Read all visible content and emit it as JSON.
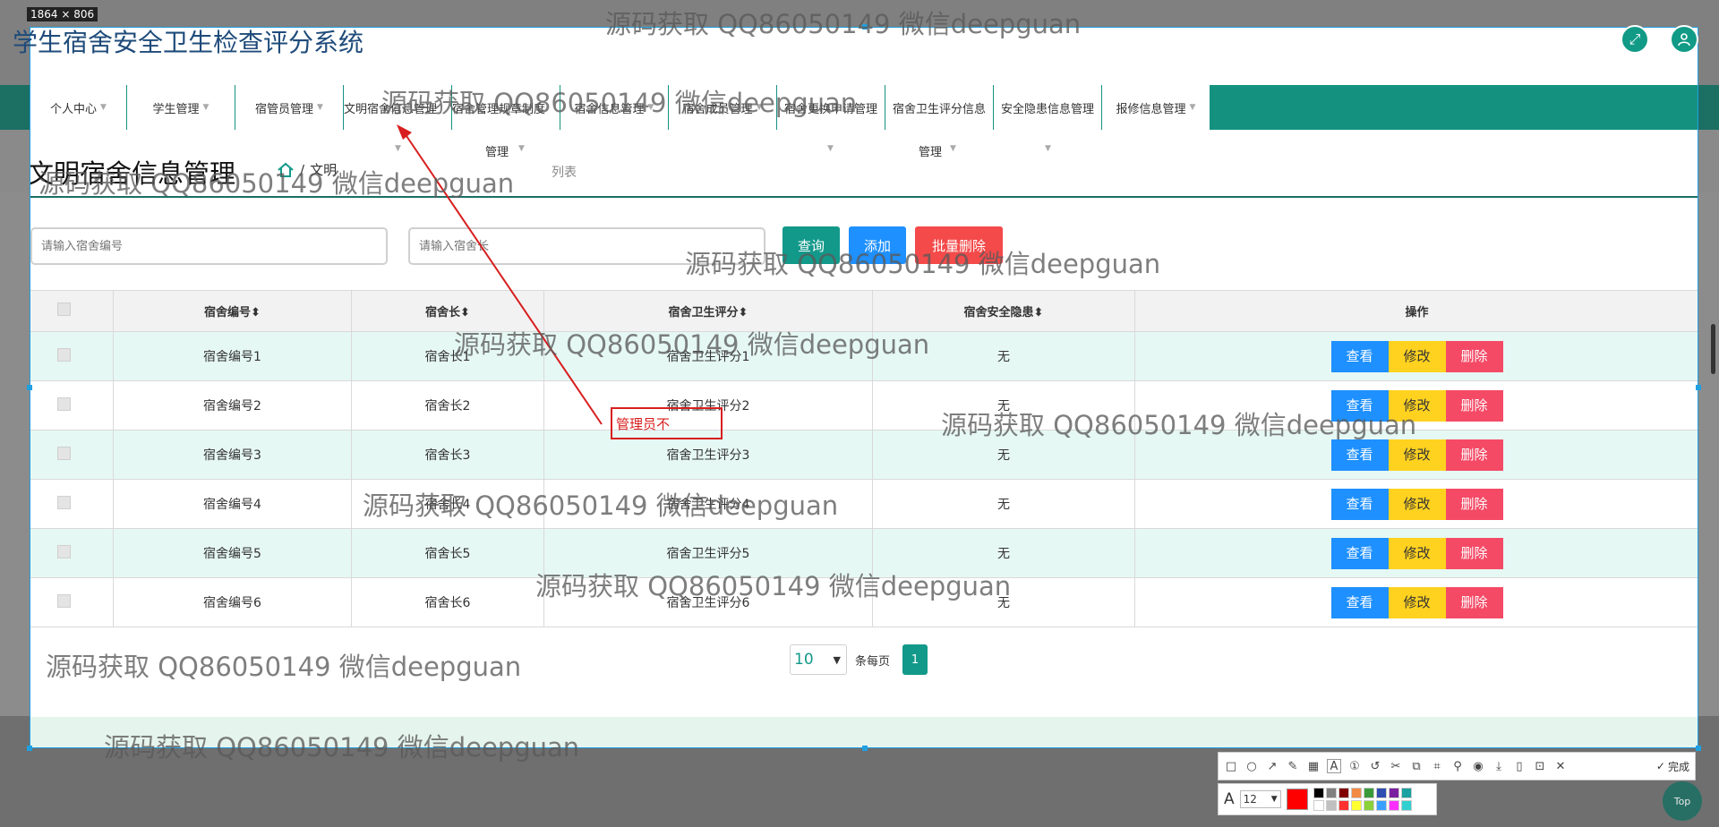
{
  "app": {
    "title": "学生宿舍安全卫生检查评分系统",
    "capture_size_label": "1864 × 806"
  },
  "nav": {
    "items": [
      {
        "label": "个人中心"
      },
      {
        "label": "学生管理"
      },
      {
        "label": "宿管员管理"
      },
      {
        "label": "文明宿舍信息管理"
      },
      {
        "label": "宿舍管理规章制度"
      },
      {
        "label": "宿舍信息管理"
      },
      {
        "label": "宿舍成员管理"
      },
      {
        "label": "宿舍更换申请管理"
      },
      {
        "label": "宿舍卫生评分信息"
      },
      {
        "label": "安全隐患信息管理"
      },
      {
        "label": "报修信息管理"
      }
    ],
    "sub_left": "管理",
    "sub_right": "管理"
  },
  "page": {
    "title": "文明宿舍信息管理",
    "breadcrumb_current": "文明",
    "breadcrumb_tail": "列表"
  },
  "search": {
    "dorm_no_placeholder": "请输入宿舍编号",
    "dorm_head_placeholder": "请输入宿舍长",
    "query_label": "查询",
    "add_label": "添加",
    "bulk_delete_label": "批量删除"
  },
  "table": {
    "headers": [
      "宿舍编号",
      "宿舍长",
      "宿舍卫生评分",
      "宿舍安全隐患",
      "操作"
    ],
    "sort_glyph": "⬍",
    "rows": [
      {
        "no": "宿舍编号1",
        "head": "宿舍长1",
        "score": "宿舍卫生评分1",
        "hazard": "无"
      },
      {
        "no": "宿舍编号2",
        "head": "宿舍长2",
        "score": "宿舍卫生评分2",
        "hazard": "无"
      },
      {
        "no": "宿舍编号3",
        "head": "宿舍长3",
        "score": "宿舍卫生评分3",
        "hazard": "无"
      },
      {
        "no": "宿舍编号4",
        "head": "宿舍长4",
        "score": "宿舍卫生评分4",
        "hazard": "无"
      },
      {
        "no": "宿舍编号5",
        "head": "宿舍长5",
        "score": "宿舍卫生评分5",
        "hazard": "无"
      },
      {
        "no": "宿舍编号6",
        "head": "宿舍长6",
        "score": "宿舍卫生评分6",
        "hazard": "无"
      }
    ],
    "actions": {
      "view": "查看",
      "edit": "修改",
      "delete": "删除"
    }
  },
  "pagination": {
    "page_size": "10",
    "per_page_label": "条每页",
    "current_page": "1"
  },
  "annotation": {
    "text": "管理员不",
    "color": "#d81e1e"
  },
  "watermark": "源码获取 QQ86050149 微信deepguan",
  "toolbar": {
    "done_label": "完成",
    "font_size": "12",
    "current_color": "#ff0000",
    "palette": [
      "#000000",
      "#808080",
      "#800000",
      "#f28a44",
      "#3a9a3a",
      "#2e4fb0",
      "#7a1fa0",
      "#1aa0a0",
      "#ffffff",
      "#c0c0c0",
      "#ff3030",
      "#ffff30",
      "#8ad13a",
      "#3aa0ff",
      "#ff30ff",
      "#30d0d0"
    ]
  },
  "top_button_label": "Top"
}
